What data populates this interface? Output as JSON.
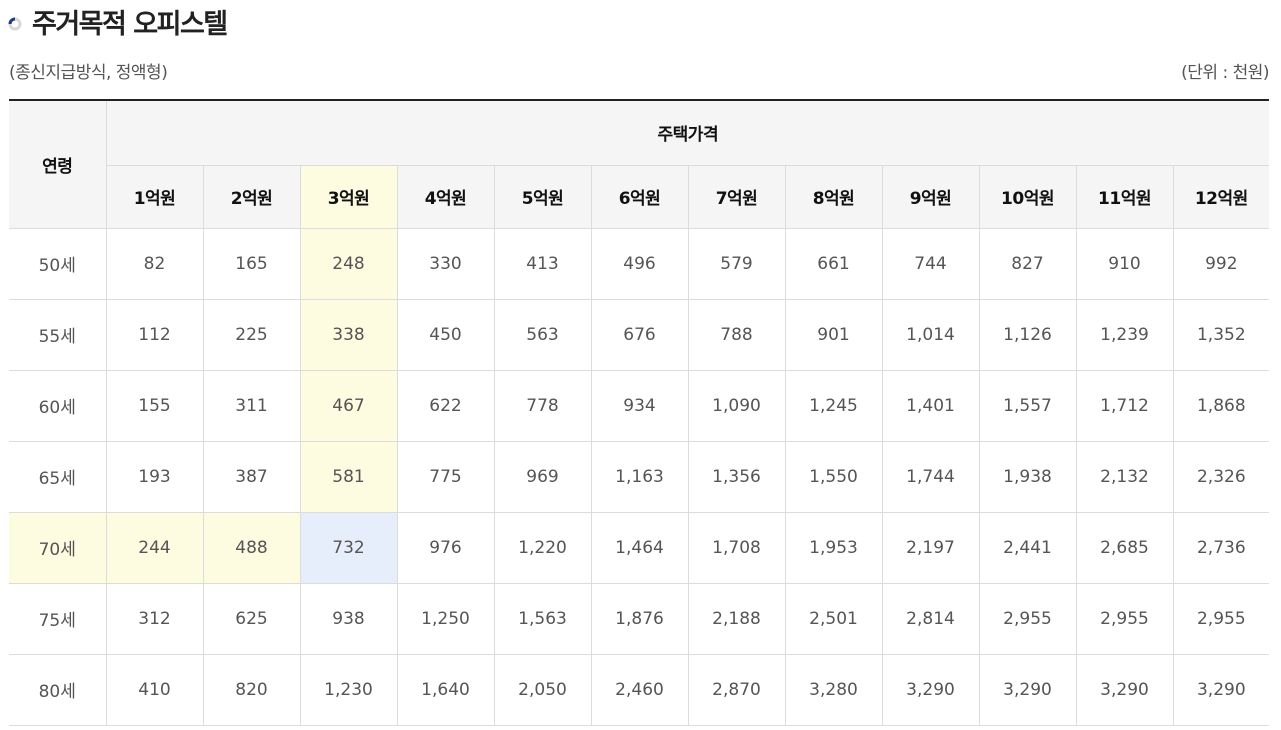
{
  "title": "주거목적 오피스텔",
  "subtitle": "(종신지급방식, 정액형)",
  "unit": "(단위 : 천원)",
  "colors": {
    "highlight_yellow": "#fdfbe0",
    "highlight_blue": "#e7eefb",
    "header_bg": "#f5f5f5",
    "title_icon_accent": "#1e3a8a"
  },
  "table": {
    "age_header": "연령",
    "price_header": "주택가격",
    "price_columns": [
      "1억원",
      "2억원",
      "3억원",
      "4억원",
      "5억원",
      "6억원",
      "7억원",
      "8억원",
      "9억원",
      "10억원",
      "11억원",
      "12억원"
    ],
    "highlight_column": "3억원",
    "highlight_row": "70세",
    "rows": [
      {
        "age": "50세",
        "values": [
          "82",
          "165",
          "248",
          "330",
          "413",
          "496",
          "579",
          "661",
          "744",
          "827",
          "910",
          "992"
        ]
      },
      {
        "age": "55세",
        "values": [
          "112",
          "225",
          "338",
          "450",
          "563",
          "676",
          "788",
          "901",
          "1,014",
          "1,126",
          "1,239",
          "1,352"
        ]
      },
      {
        "age": "60세",
        "values": [
          "155",
          "311",
          "467",
          "622",
          "778",
          "934",
          "1,090",
          "1,245",
          "1,401",
          "1,557",
          "1,712",
          "1,868"
        ]
      },
      {
        "age": "65세",
        "values": [
          "193",
          "387",
          "581",
          "775",
          "969",
          "1,163",
          "1,356",
          "1,550",
          "1,744",
          "1,938",
          "2,132",
          "2,326"
        ]
      },
      {
        "age": "70세",
        "values": [
          "244",
          "488",
          "732",
          "976",
          "1,220",
          "1,464",
          "1,708",
          "1,953",
          "2,197",
          "2,441",
          "2,685",
          "2,736"
        ]
      },
      {
        "age": "75세",
        "values": [
          "312",
          "625",
          "938",
          "1,250",
          "1,563",
          "1,876",
          "2,188",
          "2,501",
          "2,814",
          "2,955",
          "2,955",
          "2,955"
        ]
      },
      {
        "age": "80세",
        "values": [
          "410",
          "820",
          "1,230",
          "1,640",
          "2,050",
          "2,460",
          "2,870",
          "3,280",
          "3,290",
          "3,290",
          "3,290",
          "3,290"
        ]
      }
    ]
  }
}
